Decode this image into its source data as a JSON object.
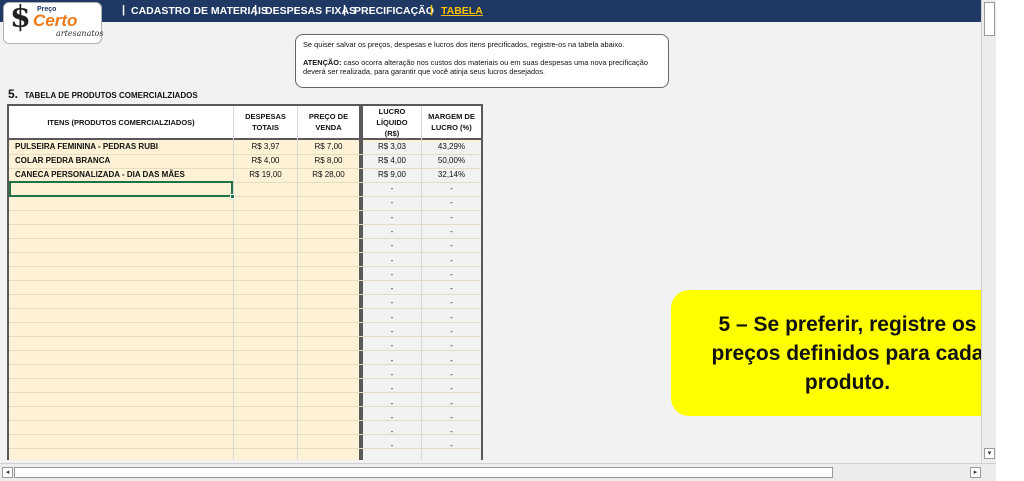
{
  "logo": {
    "symbol": "$",
    "preco": "Preço",
    "certo": "Certo",
    "artesanatos": "artesanatos"
  },
  "nav": {
    "separator": "|",
    "items": [
      {
        "label": "CADASTRO DE MATERIAIS"
      },
      {
        "label": "DESPESAS FIXAS"
      },
      {
        "label": "PRECIFICAÇÃO"
      },
      {
        "label": "TABELA",
        "active": true
      }
    ]
  },
  "info": {
    "line1": "Se quiser salvar os preços, despesas e lucros dos itens precificados, registre-os na tabela abaixo.",
    "attention_label": "ATENÇÃO:",
    "line2": "caso ocorra alteração nos custos dos materiais ou em suas despesas uma nova precificação deverá ser realizada, para garantir que você atinja seus lucros desejados."
  },
  "section": {
    "number": "5.",
    "title": "TABELA DE PRODUTOS COMERCIALZIADOS"
  },
  "table": {
    "headers": {
      "item": "ITENS (PRODUTOS COMERCIALZIADOS)",
      "despesas": "DESPESAS TOTAIS",
      "preco": "PREÇO DE VENDA",
      "lucro": "LUCRO LÍQUIDO (R$)",
      "margem": "MARGEM DE LUCRO (%)"
    },
    "rows": [
      {
        "item": "PULSEIRA FEMININA - PEDRAS RUBI",
        "despesas": "R$ 3,97",
        "preco": "R$ 7,00",
        "lucro": "R$ 3,03",
        "margem": "43,29%"
      },
      {
        "item": "COLAR PEDRA BRANCA",
        "despesas": "R$ 4,00",
        "preco": "R$ 8,00",
        "lucro": "R$ 4,00",
        "margem": "50,00%"
      },
      {
        "item": "CANECA PERSONALIZADA - DIA DAS MÃES",
        "despesas": "R$ 19,00",
        "preco": "R$ 28,00",
        "lucro": "R$ 9,00",
        "margem": "32,14%"
      }
    ],
    "empty_placeholder": "-"
  },
  "callout": {
    "text": "5 – Se preferir, registre os preços definidos para cada produto."
  },
  "scroll": {
    "up": "▴",
    "down": "▾",
    "left": "◂",
    "right": "▸"
  },
  "colors": {
    "nav_bg": "#1f3864",
    "active_tab": "#ffc000",
    "callout_bg": "#ffff00",
    "input_fill": "#fdf2d6"
  }
}
